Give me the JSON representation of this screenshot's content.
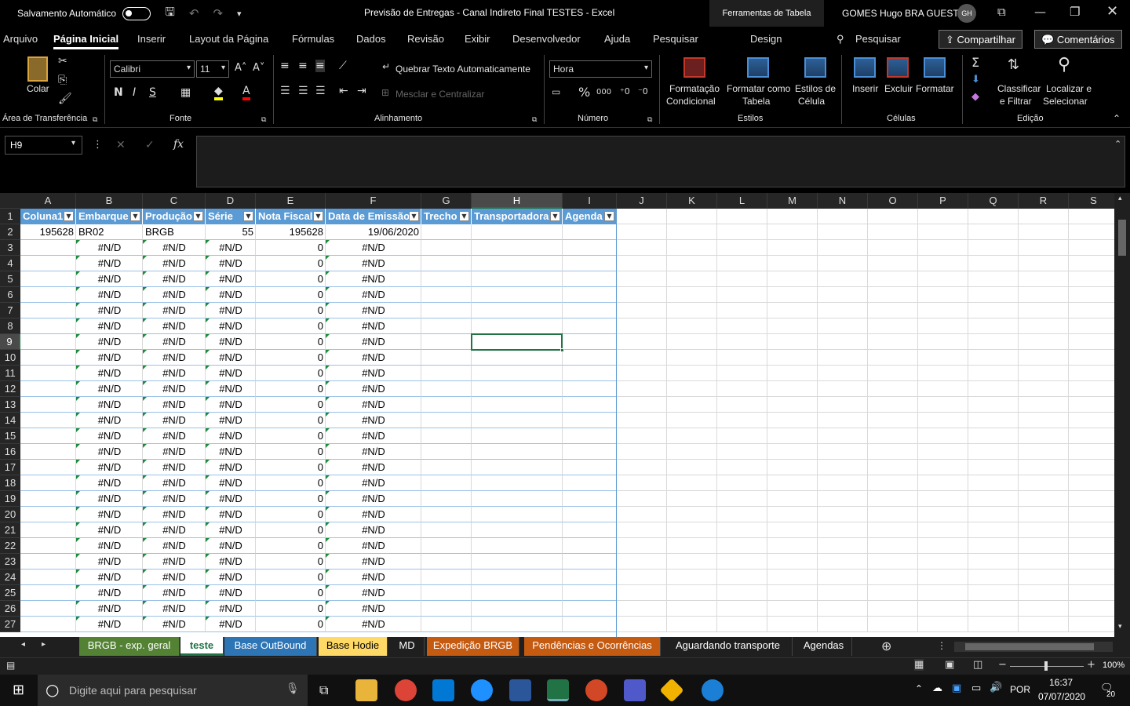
{
  "titlebar": {
    "autosave_label": "Salvamento Automático",
    "title": "Previsão de Entregas - Canal Indireto Final TESTES  -  Excel",
    "tools": "Ferramentas de Tabela",
    "user": "GOMES Hugo BRA GUEST",
    "initials": "GH"
  },
  "menu": {
    "items": [
      "Arquivo",
      "Página Inicial",
      "Inserir",
      "Layout da Página",
      "Fórmulas",
      "Dados",
      "Revisão",
      "Exibir",
      "Desenvolvedor",
      "Ajuda",
      "Pesquisar",
      "Design"
    ],
    "search": "Pesquisar",
    "share": "Compartilhar",
    "comments": "Comentários"
  },
  "ribbon": {
    "paste": "Colar",
    "clipboard": "Área de Transferência",
    "font_name": "Calibri",
    "font_size": "11",
    "font_group": "Fonte",
    "wrap": "Quebrar Texto Automaticamente",
    "merge": "Mesclar e Centralizar",
    "alignment": "Alinhamento",
    "number_format": "Hora",
    "number": "Número",
    "cond_format_1": "Formatação",
    "cond_format_2": "Condicional",
    "format_table_1": "Formatar como",
    "format_table_2": "Tabela",
    "cell_styles_1": "Estilos de",
    "cell_styles_2": "Célula",
    "styles": "Estilos",
    "insert": "Inserir",
    "delete": "Excluir",
    "format": "Formatar",
    "cells": "Células",
    "sort_1": "Classificar",
    "sort_2": "e Filtrar",
    "find_1": "Localizar e",
    "find_2": "Selecionar",
    "editing": "Edição"
  },
  "formula": {
    "name_box": "H9",
    "fx": "fx"
  },
  "columns": [
    "A",
    "B",
    "C",
    "D",
    "E",
    "F",
    "G",
    "H",
    "I",
    "J",
    "K",
    "L",
    "M",
    "N",
    "O",
    "P",
    "Q",
    "R",
    "S"
  ],
  "table": {
    "headers": [
      "Coluna1",
      "Embarque",
      "Produção",
      "Série",
      "Nota Fiscal",
      "Data de Emissão",
      "Trecho",
      "Transportadora",
      "Agenda"
    ],
    "row2": [
      "195628",
      "BR02",
      "BRGB",
      "55",
      "195628",
      "19/06/2020"
    ],
    "error_value": "#N/D",
    "zero_value": "0",
    "rows": [
      "1",
      "2",
      "3",
      "4",
      "5",
      "6",
      "7",
      "8",
      "9",
      "10",
      "11",
      "12",
      "13",
      "14",
      "15",
      "16",
      "17",
      "18",
      "19",
      "20",
      "21",
      "22",
      "23",
      "24",
      "25",
      "26",
      "27"
    ]
  },
  "tabs": [
    "BRGB - exp. geral",
    "teste",
    "Base OutBound",
    "Base Hodie",
    "MD",
    "Expedição BRGB",
    "Pendências e Ocorrências",
    "Aguardando transporte",
    "Agendas"
  ],
  "tab_colors": [
    "#548235",
    "#ffffff",
    "#2e75b6",
    "#ffd966",
    "#1f1f1f",
    "#c55a11",
    "#c55a11",
    "#1f1f1f",
    "#1f1f1f"
  ],
  "status": {
    "zoom": "100%"
  },
  "taskbar": {
    "search": "Digite aqui para pesquisar",
    "lang": "POR",
    "time": "16:37",
    "date": "07/07/2020",
    "notif": "20"
  }
}
